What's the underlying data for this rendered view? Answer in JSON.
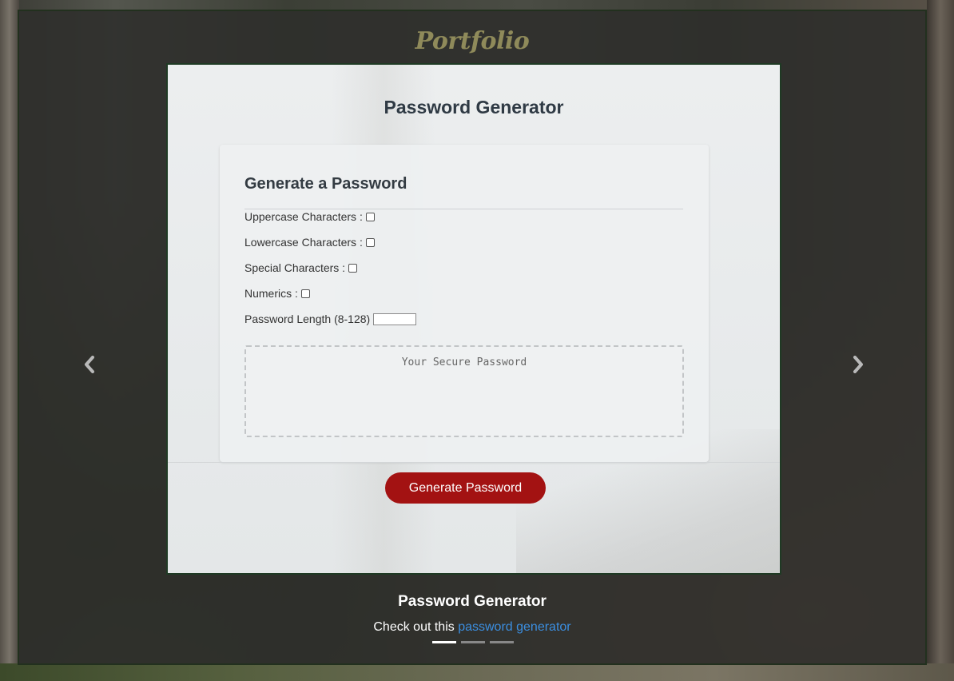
{
  "brand": "Portfolio",
  "slide": {
    "app_title": "Password Generator",
    "card": {
      "title": "Generate a Password",
      "options": {
        "uppercase": "Uppercase Characters :",
        "lowercase": "Lowercase Characters :",
        "special": "Special Characters :",
        "numerics": "Numerics :",
        "length": "Password Length (8-128)"
      },
      "output_placeholder": "Your Secure Password"
    },
    "button": "Generate Password"
  },
  "caption": {
    "title": "Password Generator",
    "text_prefix": "Check out this ",
    "link": "password generator"
  },
  "carousel": {
    "indicator_count": 3,
    "active_index": 0
  },
  "colors": {
    "button": "#a31212",
    "link": "#3b8ee0",
    "brand": "#8f8a5a"
  },
  "icons": {
    "prev": "chevron-left-icon",
    "next": "chevron-right-icon"
  }
}
